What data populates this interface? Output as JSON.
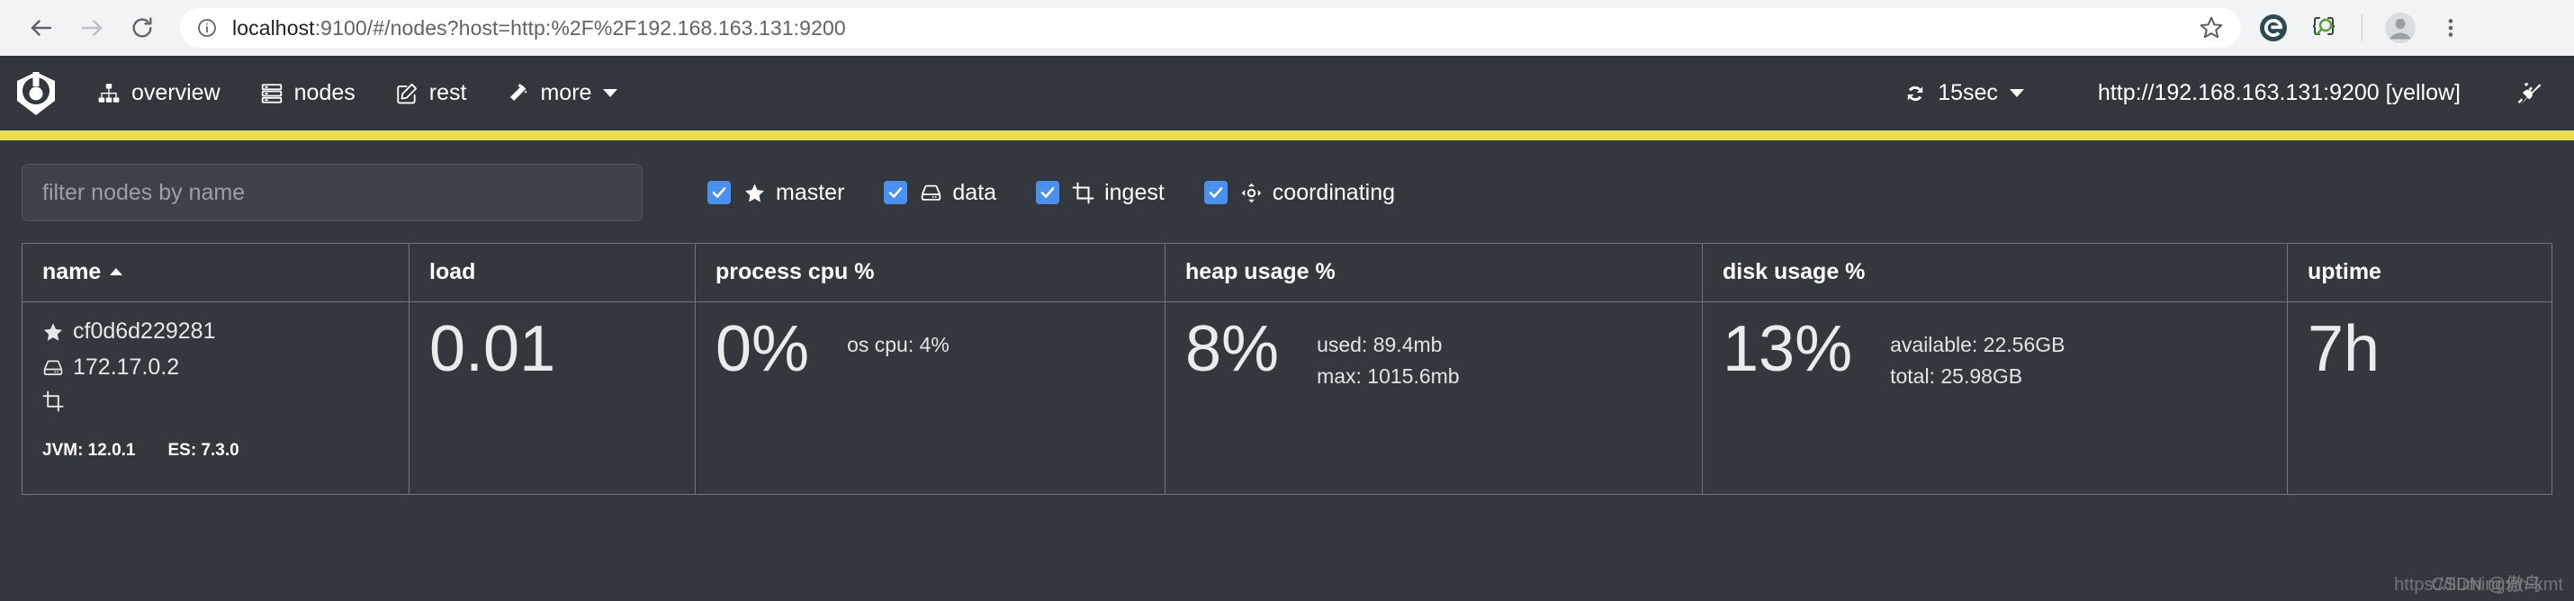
{
  "browser": {
    "back_label": "Back",
    "forward_label": "Forward",
    "reload_label": "Reload",
    "site_info_label": "View site information",
    "url_host": "localhost",
    "url_rest": ":9100/#/nodes?host=http:%2F%2F192.168.163.131:9200",
    "url_full": "localhost:9100/#/nodes?host=http:%2F%2F192.168.163.131:9200",
    "bookmark_label": "Bookmark this tab",
    "extensions": [
      {
        "name": "e-extension-icon",
        "label": "Extension"
      },
      {
        "name": "json-viewer-extension-icon",
        "label": "JSON Viewer"
      }
    ],
    "profile_label": "Profile",
    "menu_label": "Customize and control Chrome"
  },
  "navbar": {
    "logo_label": "cerebro",
    "links": [
      {
        "icon": "sitemap-icon",
        "label": "overview"
      },
      {
        "icon": "server-icon",
        "label": "nodes"
      },
      {
        "icon": "edit-square-icon",
        "label": "rest"
      },
      {
        "icon": "magic-wand-icon",
        "label": "more",
        "has_caret": true
      }
    ],
    "refresh": {
      "icon": "refresh-icon",
      "label": "15sec",
      "has_caret": true
    },
    "cluster_url": "http://192.168.163.131:9200 [yellow]",
    "disconnect_label": "disconnect",
    "health_color": "#e8dd50",
    "health_status": "yellow"
  },
  "filters": {
    "search_placeholder": "filter nodes by name",
    "search_value": "",
    "roles": [
      {
        "label": "master",
        "icon": "star-icon",
        "checked": true
      },
      {
        "label": "data",
        "icon": "disk-icon",
        "checked": true
      },
      {
        "label": "ingest",
        "icon": "crop-icon",
        "checked": true
      },
      {
        "label": "coordinating",
        "icon": "crosshair-icon",
        "checked": true
      }
    ]
  },
  "table": {
    "columns": [
      {
        "label": "name",
        "sorted": "asc"
      },
      {
        "label": "load"
      },
      {
        "label": "process cpu %"
      },
      {
        "label": "heap usage %"
      },
      {
        "label": "disk usage %"
      },
      {
        "label": "uptime"
      }
    ],
    "rows": [
      {
        "name": "cf0d6d229281",
        "ip": "172.17.0.2",
        "roles": [
          "star-icon",
          "disk-icon",
          "crop-icon"
        ],
        "jvm_label": "JVM: 12.0.1",
        "es_label": "ES: 7.3.0",
        "load": "0.01",
        "process_cpu": "0%",
        "os_cpu": "os cpu: 4%",
        "heap_pct": "8%",
        "heap_used": "used: 89.4mb",
        "heap_max": "max: 1015.6mb",
        "disk_pct": "13%",
        "disk_available": "available: 22.56GB",
        "disk_total": "total: 25.98GB",
        "uptime": "7h"
      }
    ]
  },
  "watermark": {
    "url_text": "https://liumingxin-kmt",
    "overlay_text": "CSDN @傲鸟"
  }
}
